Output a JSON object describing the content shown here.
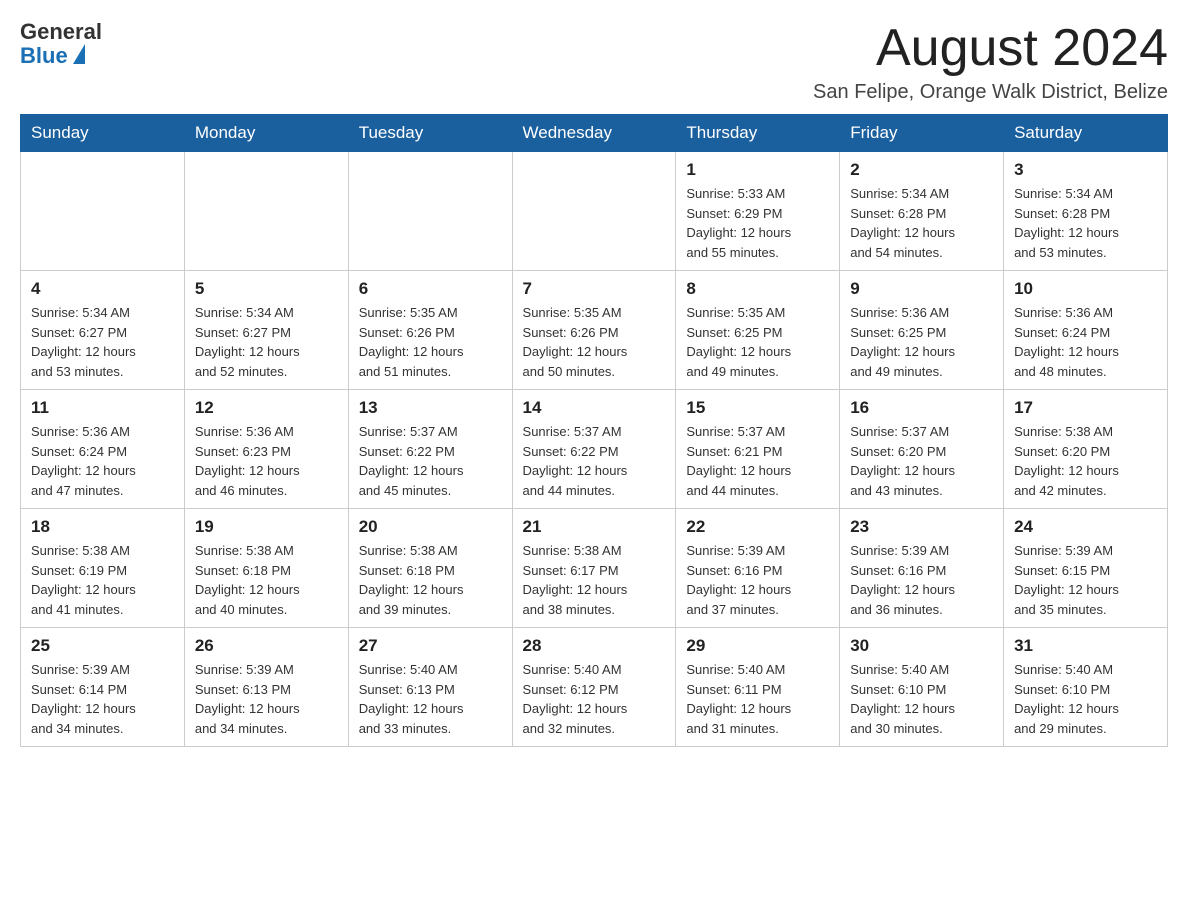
{
  "header": {
    "logo": {
      "general": "General",
      "blue": "Blue"
    },
    "month_title": "August 2024",
    "location": "San Felipe, Orange Walk District, Belize"
  },
  "weekdays": [
    "Sunday",
    "Monday",
    "Tuesday",
    "Wednesday",
    "Thursday",
    "Friday",
    "Saturday"
  ],
  "weeks": [
    [
      {
        "day": "",
        "info": ""
      },
      {
        "day": "",
        "info": ""
      },
      {
        "day": "",
        "info": ""
      },
      {
        "day": "",
        "info": ""
      },
      {
        "day": "1",
        "info": "Sunrise: 5:33 AM\nSunset: 6:29 PM\nDaylight: 12 hours\nand 55 minutes."
      },
      {
        "day": "2",
        "info": "Sunrise: 5:34 AM\nSunset: 6:28 PM\nDaylight: 12 hours\nand 54 minutes."
      },
      {
        "day": "3",
        "info": "Sunrise: 5:34 AM\nSunset: 6:28 PM\nDaylight: 12 hours\nand 53 minutes."
      }
    ],
    [
      {
        "day": "4",
        "info": "Sunrise: 5:34 AM\nSunset: 6:27 PM\nDaylight: 12 hours\nand 53 minutes."
      },
      {
        "day": "5",
        "info": "Sunrise: 5:34 AM\nSunset: 6:27 PM\nDaylight: 12 hours\nand 52 minutes."
      },
      {
        "day": "6",
        "info": "Sunrise: 5:35 AM\nSunset: 6:26 PM\nDaylight: 12 hours\nand 51 minutes."
      },
      {
        "day": "7",
        "info": "Sunrise: 5:35 AM\nSunset: 6:26 PM\nDaylight: 12 hours\nand 50 minutes."
      },
      {
        "day": "8",
        "info": "Sunrise: 5:35 AM\nSunset: 6:25 PM\nDaylight: 12 hours\nand 49 minutes."
      },
      {
        "day": "9",
        "info": "Sunrise: 5:36 AM\nSunset: 6:25 PM\nDaylight: 12 hours\nand 49 minutes."
      },
      {
        "day": "10",
        "info": "Sunrise: 5:36 AM\nSunset: 6:24 PM\nDaylight: 12 hours\nand 48 minutes."
      }
    ],
    [
      {
        "day": "11",
        "info": "Sunrise: 5:36 AM\nSunset: 6:24 PM\nDaylight: 12 hours\nand 47 minutes."
      },
      {
        "day": "12",
        "info": "Sunrise: 5:36 AM\nSunset: 6:23 PM\nDaylight: 12 hours\nand 46 minutes."
      },
      {
        "day": "13",
        "info": "Sunrise: 5:37 AM\nSunset: 6:22 PM\nDaylight: 12 hours\nand 45 minutes."
      },
      {
        "day": "14",
        "info": "Sunrise: 5:37 AM\nSunset: 6:22 PM\nDaylight: 12 hours\nand 44 minutes."
      },
      {
        "day": "15",
        "info": "Sunrise: 5:37 AM\nSunset: 6:21 PM\nDaylight: 12 hours\nand 44 minutes."
      },
      {
        "day": "16",
        "info": "Sunrise: 5:37 AM\nSunset: 6:20 PM\nDaylight: 12 hours\nand 43 minutes."
      },
      {
        "day": "17",
        "info": "Sunrise: 5:38 AM\nSunset: 6:20 PM\nDaylight: 12 hours\nand 42 minutes."
      }
    ],
    [
      {
        "day": "18",
        "info": "Sunrise: 5:38 AM\nSunset: 6:19 PM\nDaylight: 12 hours\nand 41 minutes."
      },
      {
        "day": "19",
        "info": "Sunrise: 5:38 AM\nSunset: 6:18 PM\nDaylight: 12 hours\nand 40 minutes."
      },
      {
        "day": "20",
        "info": "Sunrise: 5:38 AM\nSunset: 6:18 PM\nDaylight: 12 hours\nand 39 minutes."
      },
      {
        "day": "21",
        "info": "Sunrise: 5:38 AM\nSunset: 6:17 PM\nDaylight: 12 hours\nand 38 minutes."
      },
      {
        "day": "22",
        "info": "Sunrise: 5:39 AM\nSunset: 6:16 PM\nDaylight: 12 hours\nand 37 minutes."
      },
      {
        "day": "23",
        "info": "Sunrise: 5:39 AM\nSunset: 6:16 PM\nDaylight: 12 hours\nand 36 minutes."
      },
      {
        "day": "24",
        "info": "Sunrise: 5:39 AM\nSunset: 6:15 PM\nDaylight: 12 hours\nand 35 minutes."
      }
    ],
    [
      {
        "day": "25",
        "info": "Sunrise: 5:39 AM\nSunset: 6:14 PM\nDaylight: 12 hours\nand 34 minutes."
      },
      {
        "day": "26",
        "info": "Sunrise: 5:39 AM\nSunset: 6:13 PM\nDaylight: 12 hours\nand 34 minutes."
      },
      {
        "day": "27",
        "info": "Sunrise: 5:40 AM\nSunset: 6:13 PM\nDaylight: 12 hours\nand 33 minutes."
      },
      {
        "day": "28",
        "info": "Sunrise: 5:40 AM\nSunset: 6:12 PM\nDaylight: 12 hours\nand 32 minutes."
      },
      {
        "day": "29",
        "info": "Sunrise: 5:40 AM\nSunset: 6:11 PM\nDaylight: 12 hours\nand 31 minutes."
      },
      {
        "day": "30",
        "info": "Sunrise: 5:40 AM\nSunset: 6:10 PM\nDaylight: 12 hours\nand 30 minutes."
      },
      {
        "day": "31",
        "info": "Sunrise: 5:40 AM\nSunset: 6:10 PM\nDaylight: 12 hours\nand 29 minutes."
      }
    ]
  ]
}
